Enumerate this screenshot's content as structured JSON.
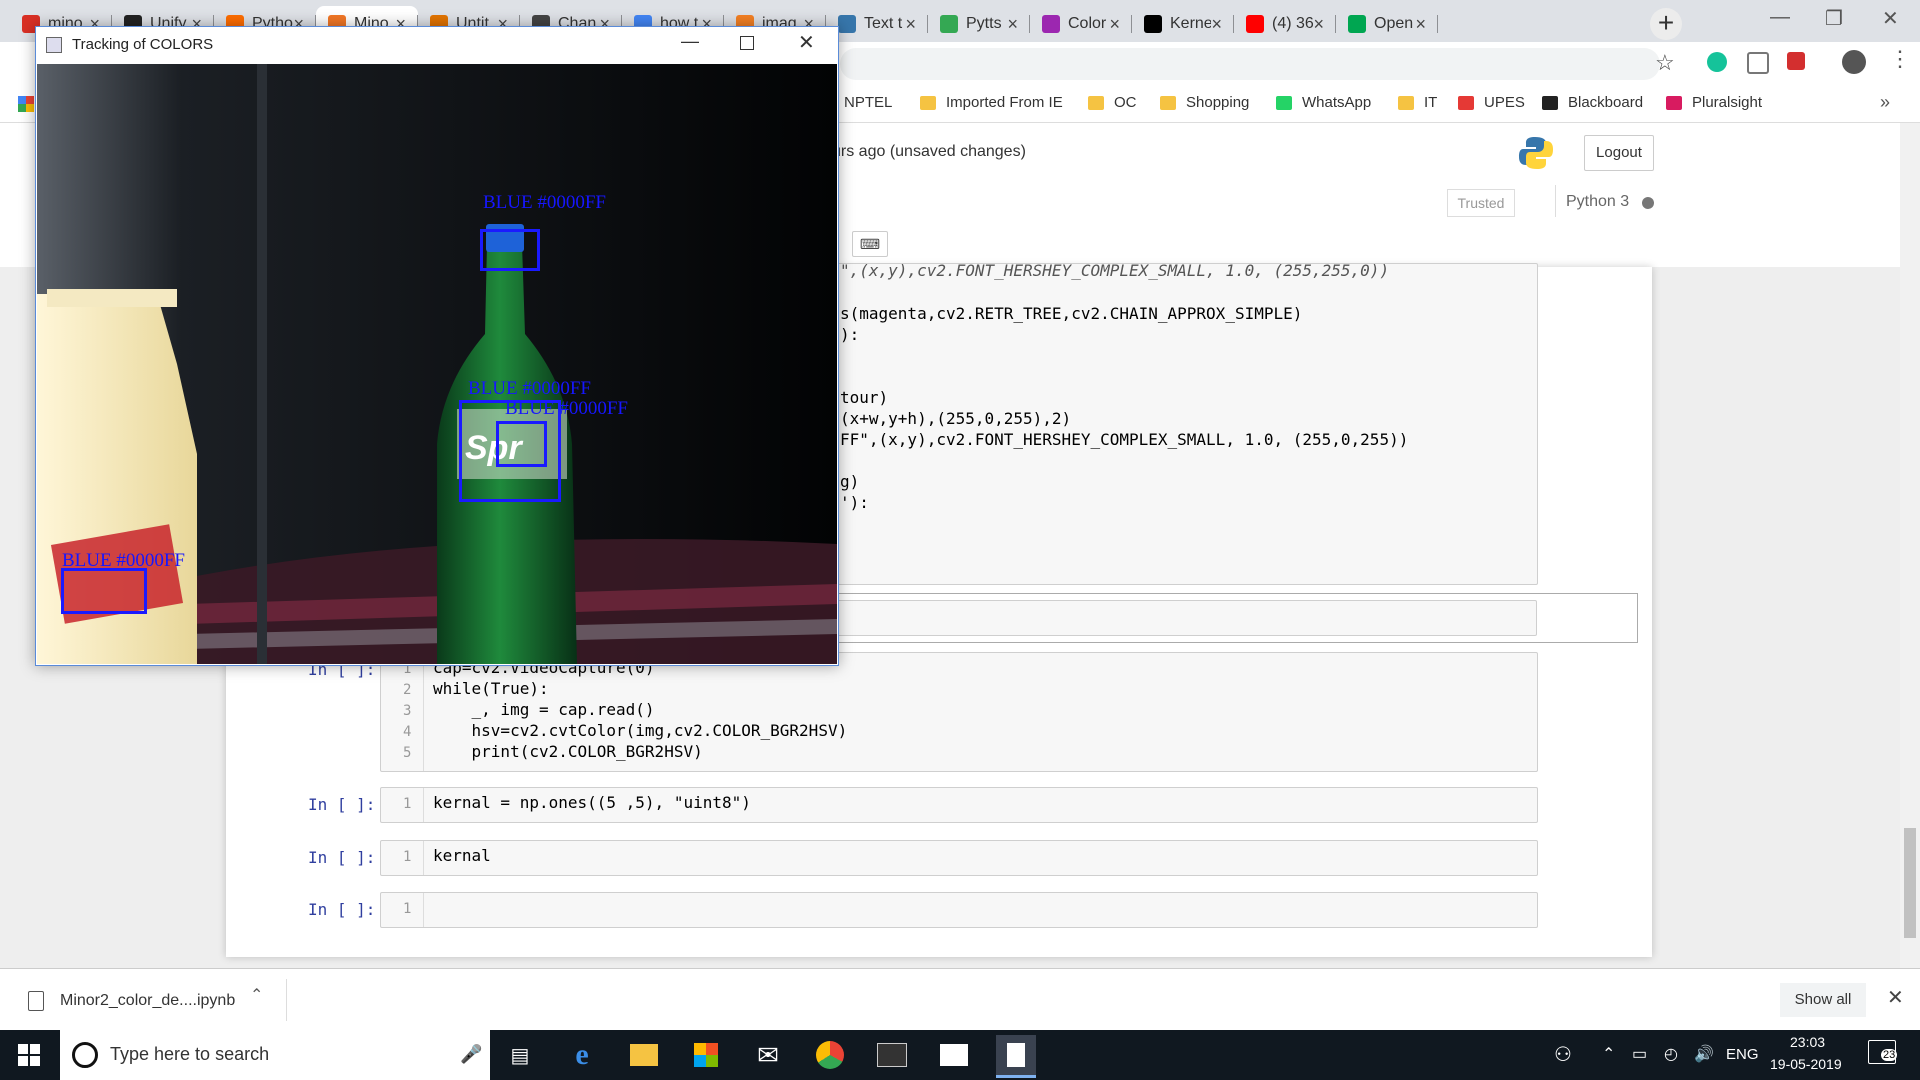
{
  "browser": {
    "tabs": [
      {
        "title": "mino",
        "icon": "gmail-icon",
        "color": "#d93025"
      },
      {
        "title": "Unify",
        "icon": "github-icon",
        "color": "#222222"
      },
      {
        "title": "Pytho",
        "icon": "orange-loader-icon",
        "color": "#ff6d00"
      },
      {
        "title": "Mino",
        "icon": "jupyter-icon",
        "color": "#f37726"
      },
      {
        "title": "Untit",
        "icon": "notebook-icon",
        "color": "#e37400"
      },
      {
        "title": "Chan",
        "icon": "table-icon",
        "color": "#444444"
      },
      {
        "title": "how t",
        "icon": "google-icon",
        "color": "#4285f4"
      },
      {
        "title": "imag",
        "icon": "stack-icon",
        "color": "#f48024"
      },
      {
        "title": "Text t",
        "icon": "python-icon",
        "color": "#3776ab"
      },
      {
        "title": "Pytts",
        "icon": "circle-icon",
        "color": "#34a853"
      },
      {
        "title": "Color",
        "icon": "color-grid-icon",
        "color": "#9c27b0"
      },
      {
        "title": "Kerne",
        "icon": "wikipedia-icon",
        "color": "#000000"
      },
      {
        "title": "(4) 36",
        "icon": "youtube-icon",
        "color": "#ff0000"
      },
      {
        "title": "Open",
        "icon": "opencv-icon",
        "color": "#00a651"
      }
    ],
    "bookmarks": [
      "NPTEL",
      "Imported From IE",
      "OC",
      "Shopping",
      "WhatsApp",
      "IT",
      "UPES",
      "Blackboard",
      "Pluralsight"
    ]
  },
  "jupyter": {
    "save_status": "urs ago  (unsaved changes)",
    "logout": "Logout",
    "trusted": "Trusted",
    "kernel": "Python 3",
    "code_fragments": [
      "\",(x,y),cv2.FONT_HERSHEY_COMPLEX_SMALL, 1.0, (255,255,0))",
      "s(magenta,cv2.RETR_TREE,cv2.CHAIN_APPROX_SIMPLE)",
      "):",
      "tour)",
      "(x+w,y+h),(255,0,255),2)",
      "FF\",(x,y),cv2.FONT_HERSHEY_COMPLEX_SMALL, 1.0, (255,0,255))",
      "g)",
      "'):"
    ],
    "cells": [
      {
        "prompt": "In [ ]:",
        "lines": [
          "cap=cv2.VideoCapture(0)",
          "while(True):",
          "    _, img = cap.read()",
          "    hsv=cv2.cvtColor(img,cv2.COLOR_BGR2HSV)",
          "    print(cv2.COLOR_BGR2HSV)"
        ]
      },
      {
        "prompt": "In [ ]:",
        "lines": [
          "kernal = np.ones((5 ,5), \"uint8\")"
        ]
      },
      {
        "prompt": "In [ ]:",
        "lines": [
          "kernal"
        ]
      },
      {
        "prompt": "In [ ]:",
        "lines": [
          ""
        ]
      }
    ]
  },
  "cv_window": {
    "title": "Tracking of COLORS",
    "labels": [
      "BLUE #0000FF",
      "BLUE #0000FF",
      "BLUE #0000FF",
      "BLUE #0000FF"
    ]
  },
  "downloads": {
    "file": "Minor2_color_de....ipynb",
    "show_all": "Show all"
  },
  "taskbar": {
    "search_placeholder": "Type here to search",
    "lang": "ENG",
    "time": "23:03",
    "date": "19-05-2019",
    "notifications": "23"
  }
}
